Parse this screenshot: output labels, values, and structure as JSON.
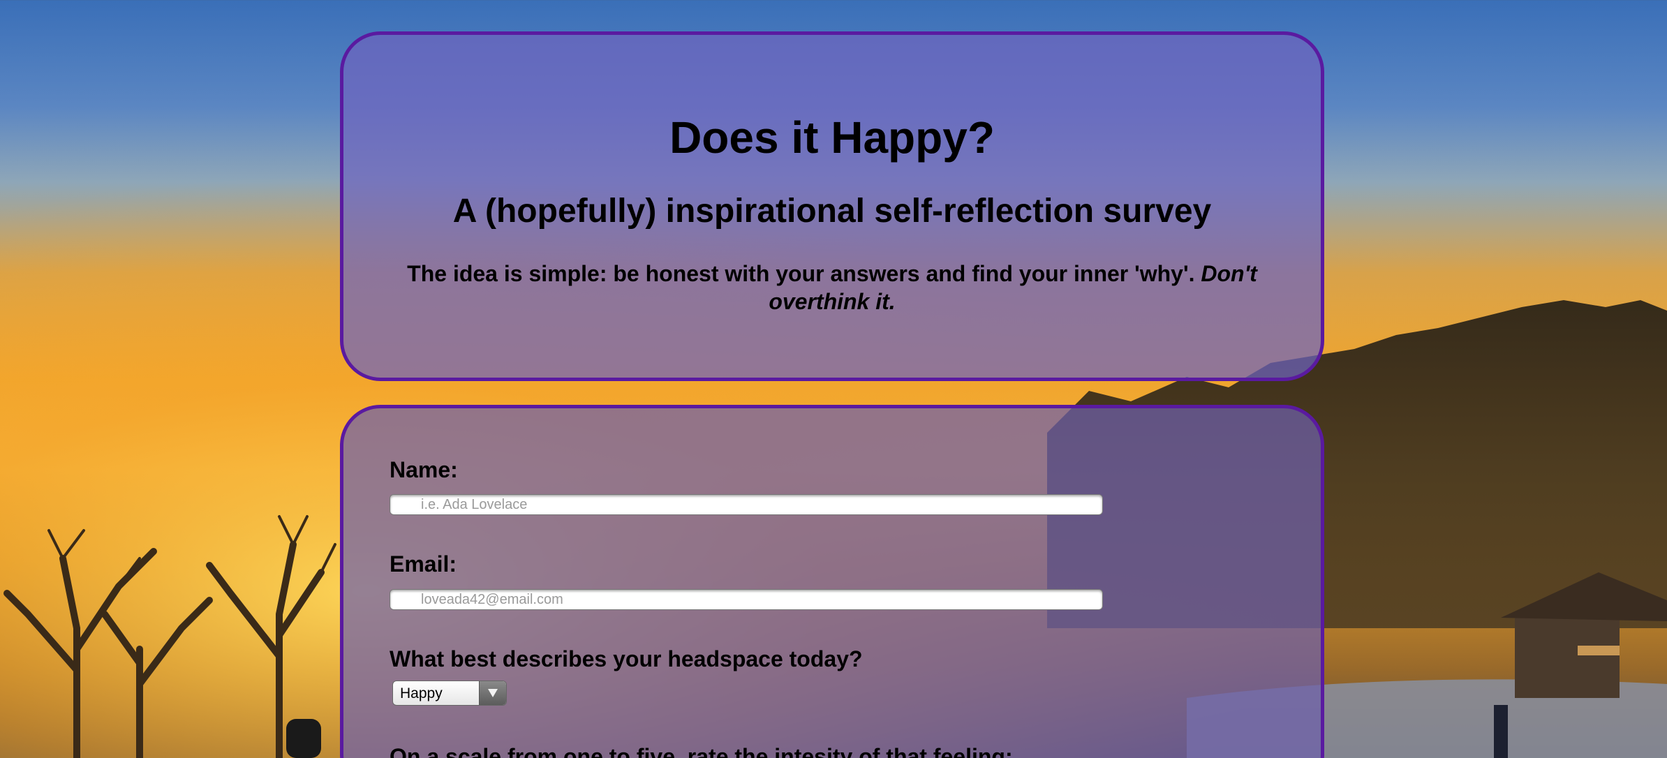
{
  "header": {
    "title": "Does it Happy?",
    "subtitle": "A (hopefully) inspirational self-reflection survey",
    "intro_text": "The idea is simple: be honest with your answers and find your inner 'why'. ",
    "intro_emphasis": "Don't overthink it."
  },
  "form": {
    "name_label": "Name:",
    "name_placeholder": "i.e. Ada Lovelace",
    "name_value": "",
    "email_label": "Email:",
    "email_placeholder": "loveada42@email.com",
    "email_value": "",
    "headspace_label": "What best describes your headspace today?",
    "headspace_selected": "Happy",
    "intensity_label": "On a scale from one to five, rate the intesity of that feeling:"
  },
  "icons": {
    "select_arrow": "triangle-down-icon"
  },
  "colors": {
    "card_border": "#5a1aa0",
    "card_fill": "#6e64be"
  }
}
